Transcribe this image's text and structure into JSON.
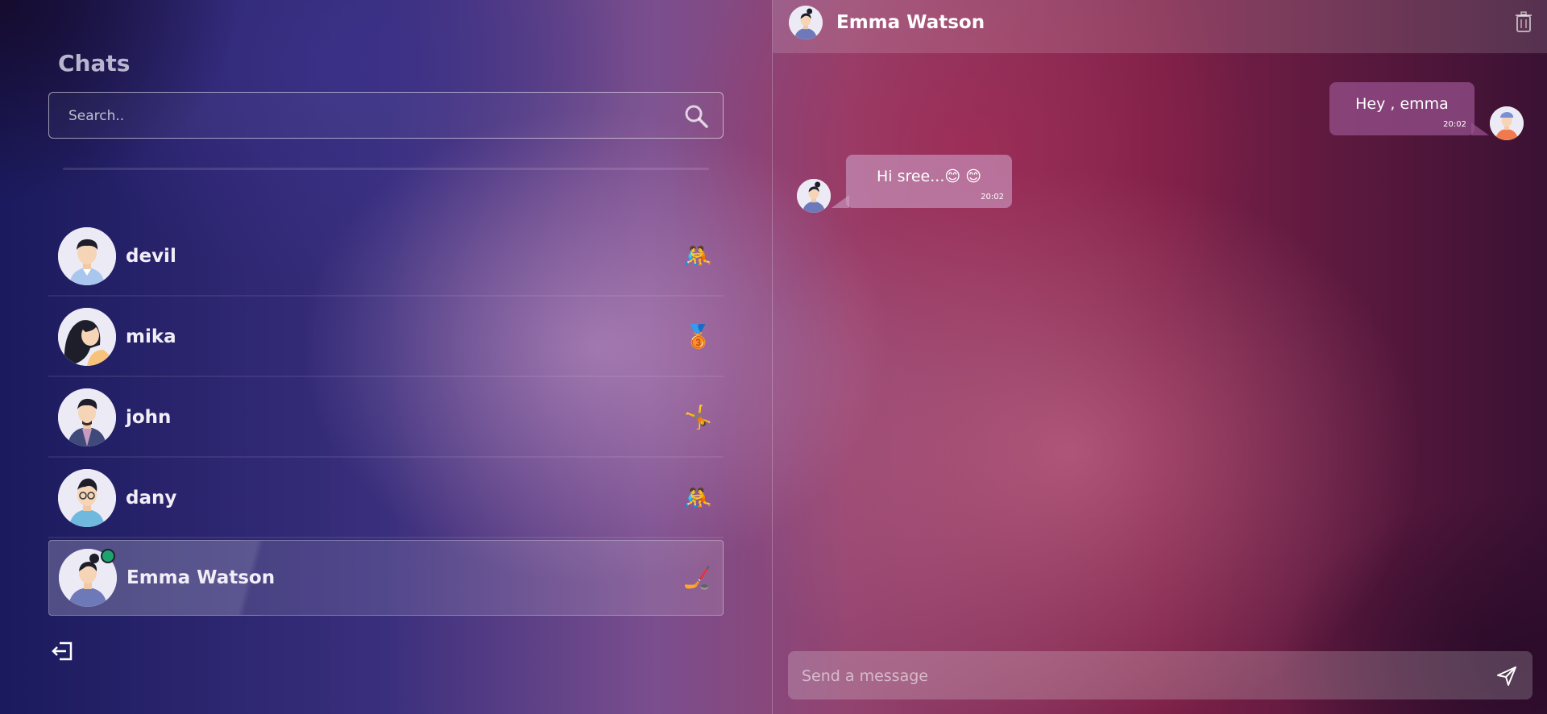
{
  "sidebar": {
    "title": "Chats",
    "search": {
      "placeholder": "Search.."
    },
    "contacts": [
      {
        "name": "devil",
        "emoji": "🤼",
        "avatar": "man-avatar"
      },
      {
        "name": "mika",
        "emoji": "🥉",
        "avatar": "woman-avatar"
      },
      {
        "name": "john",
        "emoji": "🤸",
        "avatar": "man-avatar"
      },
      {
        "name": "dany",
        "emoji": "🤼",
        "avatar": "man-avatar"
      },
      {
        "name": "Emma Watson",
        "emoji": "🏒",
        "avatar": "woman-avatar",
        "active": true,
        "online": true
      }
    ]
  },
  "chat": {
    "header": {
      "name": "Emma Watson"
    },
    "messages": [
      {
        "direction": "out",
        "text": "Hey , emma",
        "time": "20:02"
      },
      {
        "direction": "in",
        "text": "Hi sree...😊 😊",
        "time": "20:02"
      }
    ],
    "composer": {
      "placeholder": "Send a message"
    }
  },
  "colors": {
    "online": "#1da36f",
    "outgoing_bubble": "#96508c",
    "incoming_bubble": "#cda0c8"
  }
}
